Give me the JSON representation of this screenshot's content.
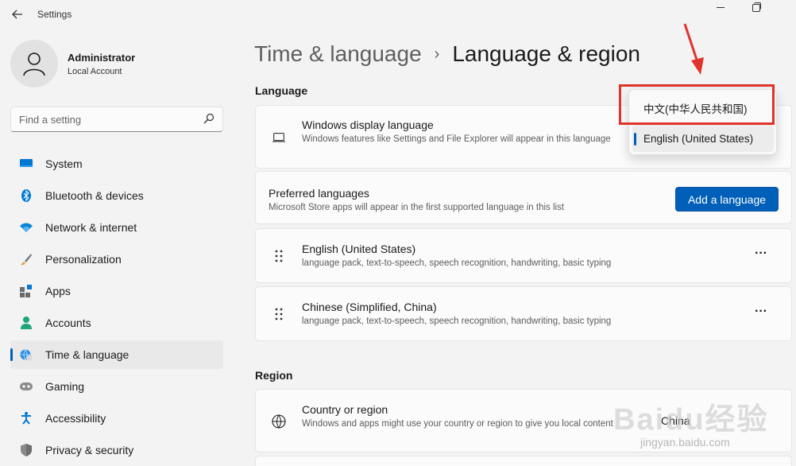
{
  "window": {
    "title": "Settings",
    "back_icon": "back-arrow-icon",
    "minimize_icon": "minimize-icon",
    "maximize_icon": "restore-icon"
  },
  "profile": {
    "name": "Administrator",
    "account_type": "Local Account"
  },
  "search": {
    "placeholder": "Find a setting"
  },
  "sidebar": {
    "items": [
      {
        "label": "System",
        "icon": "monitor-icon"
      },
      {
        "label": "Bluetooth & devices",
        "icon": "bluetooth-icon"
      },
      {
        "label": "Network & internet",
        "icon": "wifi-icon"
      },
      {
        "label": "Personalization",
        "icon": "brush-icon"
      },
      {
        "label": "Apps",
        "icon": "apps-icon"
      },
      {
        "label": "Accounts",
        "icon": "person-icon"
      },
      {
        "label": "Time & language",
        "icon": "globe-clock-icon",
        "active": true
      },
      {
        "label": "Gaming",
        "icon": "gamepad-icon"
      },
      {
        "label": "Accessibility",
        "icon": "accessibility-icon"
      },
      {
        "label": "Privacy & security",
        "icon": "shield-icon"
      }
    ]
  },
  "breadcrumb": {
    "parent": "Time & language",
    "separator": "›",
    "current": "Language & region"
  },
  "language_section": {
    "title": "Language",
    "display_language": {
      "title": "Windows display language",
      "description": "Windows features like Settings and File Explorer will appear in this language",
      "icon": "laptop-icon"
    },
    "preferred": {
      "title": "Preferred languages",
      "description": "Microsoft Store apps will appear in the first supported language in this list",
      "button": "Add a language"
    },
    "languages": [
      {
        "name": "English (United States)",
        "details": "language pack, text-to-speech, speech recognition, handwriting, basic typing",
        "more": "···"
      },
      {
        "name": "Chinese (Simplified, China)",
        "details": "language pack, text-to-speech, speech recognition, handwriting, basic typing",
        "more": "···"
      }
    ]
  },
  "dropdown": {
    "options": [
      "中文(中华人民共和国)",
      "English (United States)"
    ],
    "selected": "English (United States)"
  },
  "region_section": {
    "title": "Region",
    "country": {
      "title": "Country or region",
      "description": "Windows and apps might use your country or region to give you local content",
      "value": "China",
      "icon": "globe-icon"
    }
  },
  "watermark": {
    "brand": "Baidu经验",
    "url": "jingyan.baidu.com"
  },
  "colors": {
    "accent": "#005fb8",
    "annotation_red": "#e0332b"
  }
}
